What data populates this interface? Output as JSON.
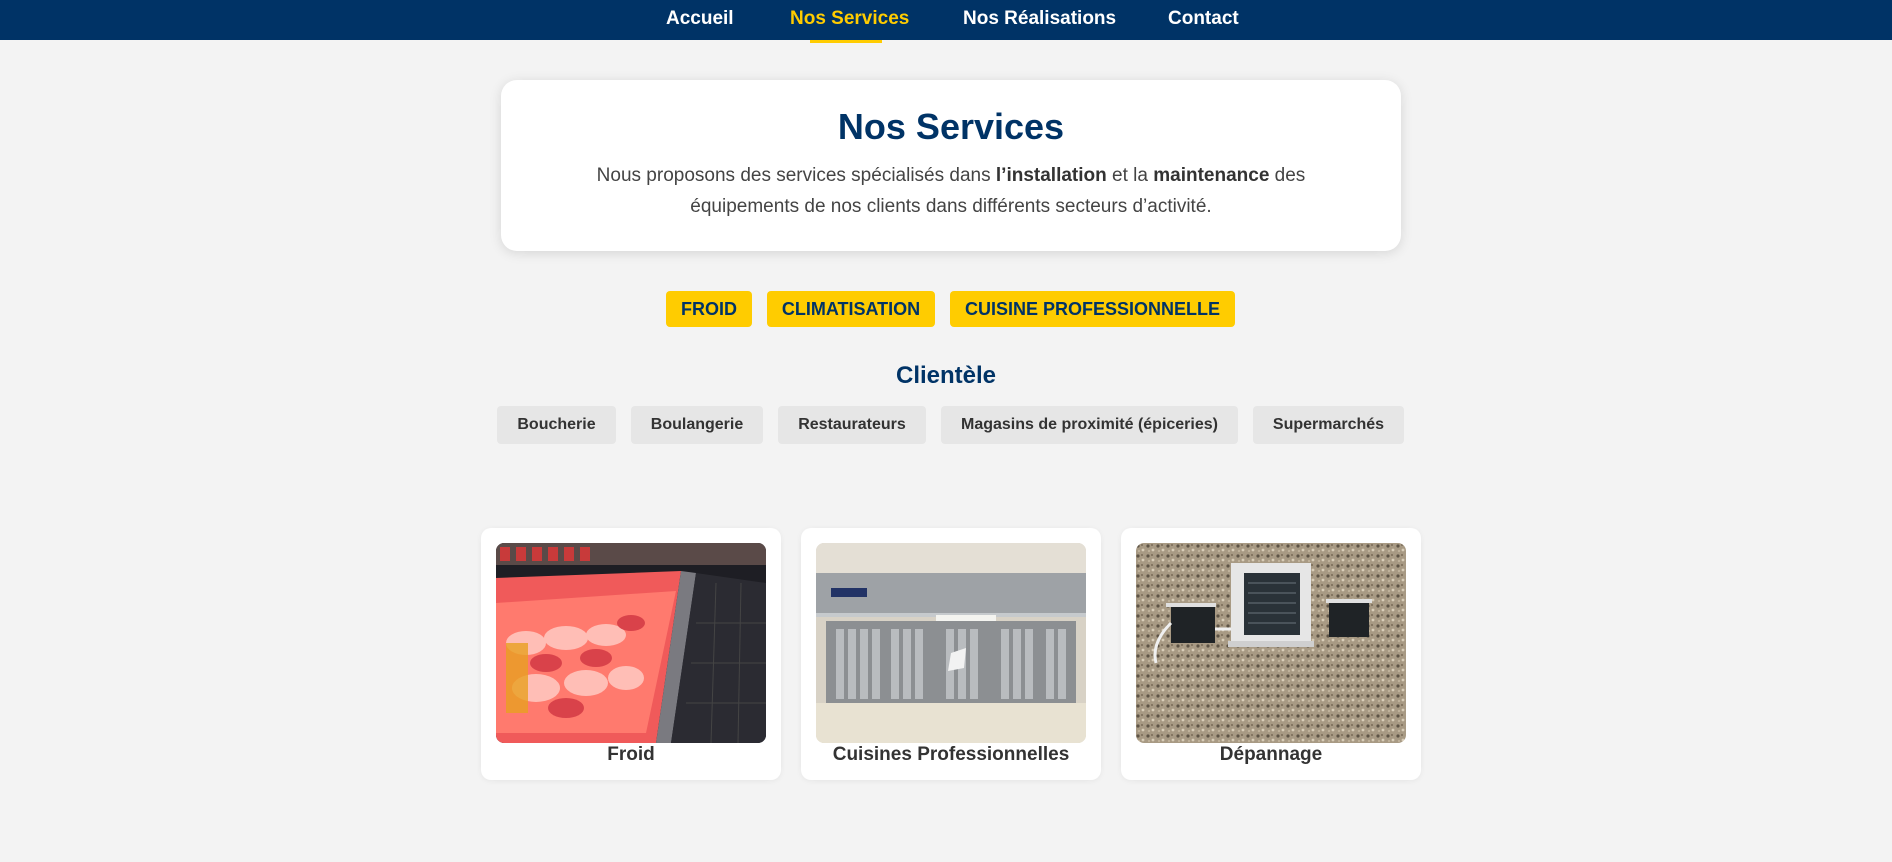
{
  "nav": {
    "items": [
      {
        "label": "Accueil",
        "active": false
      },
      {
        "label": "Nos Services",
        "active": true
      },
      {
        "label": "Nos Réalisations",
        "active": false
      },
      {
        "label": "Contact",
        "active": false
      }
    ]
  },
  "intro": {
    "title": "Nos Services",
    "text_part1": "Nous proposons des services spécialisés dans ",
    "bold1": "l’installation",
    "text_part2": " et la ",
    "bold2": "maintenance",
    "text_part3": " des équipements de nos clients dans différents secteurs d’activité."
  },
  "categories": [
    "FROID",
    "CLIMATISATION",
    "CUISINE PROFESSIONNELLE"
  ],
  "clientele": {
    "heading": "Clientèle",
    "items": [
      "Boucherie",
      "Boulangerie",
      "Restaurateurs",
      "Magasins de proximité (épiceries)",
      "Supermarchés"
    ]
  },
  "services": [
    {
      "label": "Froid",
      "image": "refrigerated-meat-display-photo"
    },
    {
      "label": "Cuisines Professionnelles",
      "image": "kitchen-extraction-hood-photo"
    },
    {
      "label": "Dépannage",
      "image": "rooftop-condenser-units-photo"
    }
  ],
  "colors": {
    "navy": "#003366",
    "accent_yellow": "#ffcc00",
    "background": "#f3f3f3",
    "tag_grey": "#e6e6e6"
  }
}
